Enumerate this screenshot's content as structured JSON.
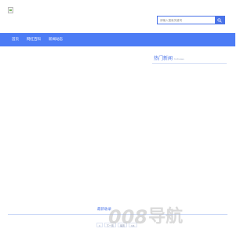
{
  "header": {
    "logo_icon": "broken-image-icon",
    "search": {
      "placeholder": "请输入搜索关键词",
      "button_icon": "search-icon"
    }
  },
  "nav": {
    "items": [
      {
        "label": "首页"
      },
      {
        "label": "网红百科"
      },
      {
        "label": "新闻动态"
      }
    ]
  },
  "sidebar": {
    "hot_news_title": "热门新闻",
    "hot_news_subtitle": "hotnews"
  },
  "main": {
    "latest_title": "最新收录",
    "pagination": [
      {
        "label": "1"
      },
      {
        "label": "下一页"
      },
      {
        "label": "尾页"
      },
      {
        "label": "1/1"
      }
    ]
  },
  "watermark": {
    "digits": "008",
    "text": "导航"
  },
  "colors": {
    "accent": "#4a73e8",
    "nav_bg": "#4c7cf5",
    "watermark": "#b7b7b7"
  }
}
